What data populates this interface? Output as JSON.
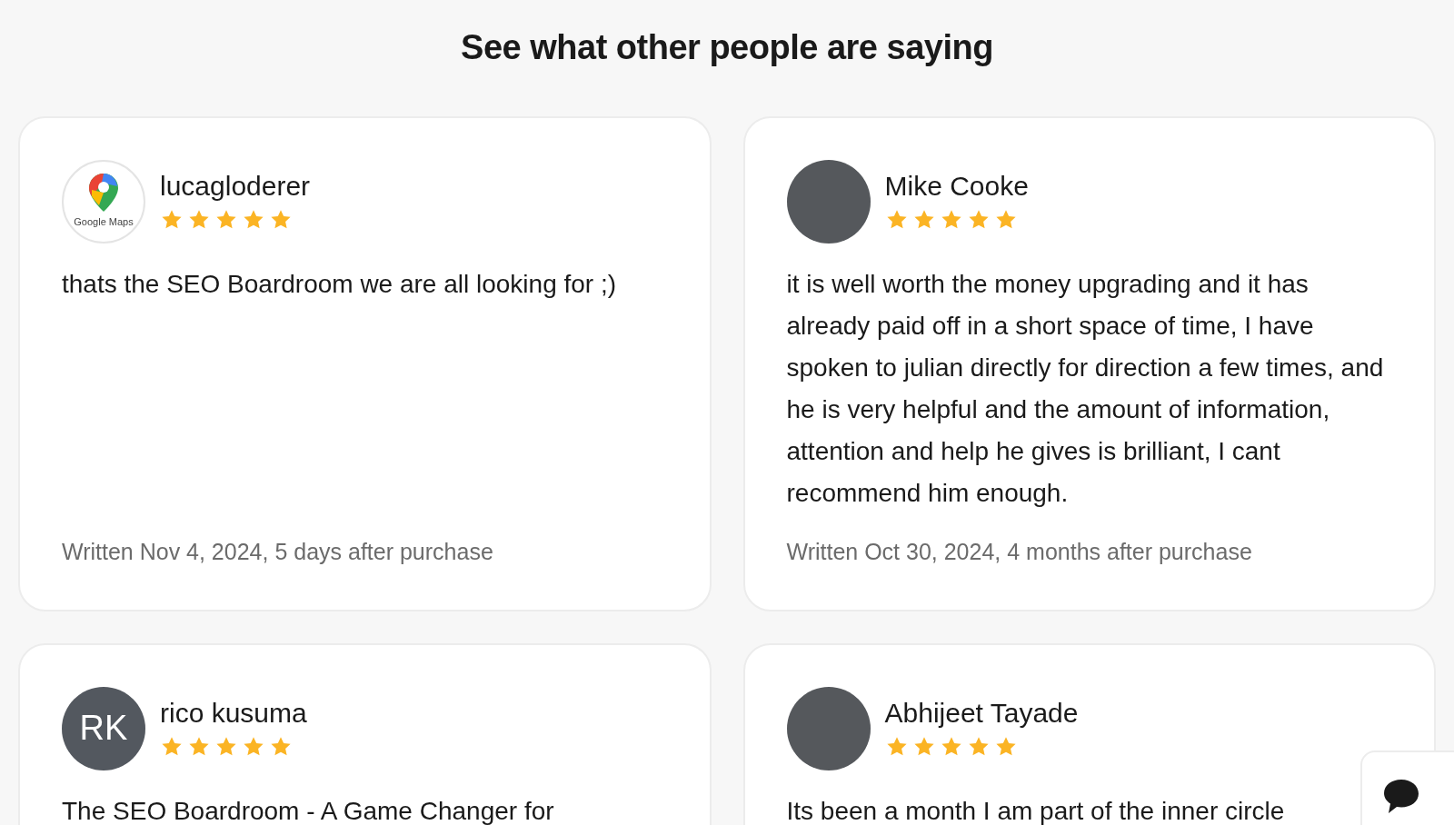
{
  "heading": "See what other people are saying",
  "reviews": [
    {
      "name": "lucagloderer",
      "stars": 5,
      "avatar": {
        "kind": "logo",
        "label": "Google Maps"
      },
      "text": "thats the SEO Boardroom we are all looking for ;)",
      "footer": "Written Nov 4, 2024, 5 days after purchase"
    },
    {
      "name": "Mike Cooke",
      "stars": 5,
      "avatar": {
        "kind": "photo"
      },
      "text": "it is well worth the money upgrading and it has already paid off in a short space of time, I have spoken to julian directly for direction a few times, and he is very helpful and the amount of information, attention and help he gives is brilliant, I cant recommend him enough.",
      "footer": "Written Oct 30, 2024, 4 months after purchase"
    },
    {
      "name": "rico kusuma",
      "stars": 5,
      "avatar": {
        "kind": "initials",
        "label": "RK"
      },
      "text": "The SEO Boardroom - A Game Changer for"
    },
    {
      "name": "Abhijeet Tayade",
      "stars": 5,
      "avatar": {
        "kind": "photo"
      },
      "text": "Its been a month I am part of the inner circle"
    }
  ]
}
